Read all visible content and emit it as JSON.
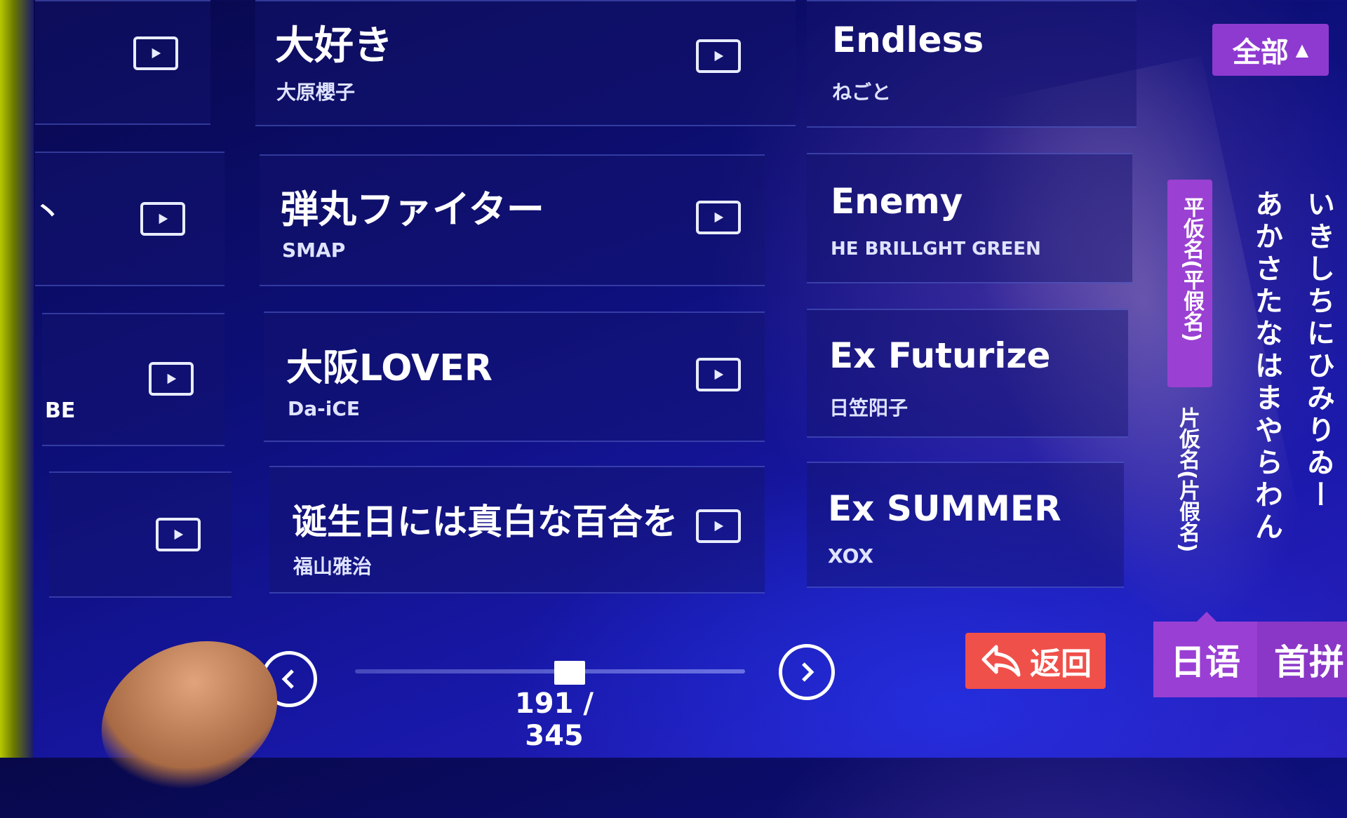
{
  "songs": {
    "left_column": [
      {
        "title": "大好き",
        "artist": "大原櫻子"
      },
      {
        "title": "弾丸ファイター",
        "artist": "SMAP"
      },
      {
        "title": "大阪LOVER",
        "artist": "Da-iCE"
      },
      {
        "title": "诞生日には真白な百合を",
        "artist": "福山雅治"
      }
    ],
    "right_column": [
      {
        "title": "Endless",
        "artist": "ねごと"
      },
      {
        "title": "Enemy",
        "artist": "HE BRILLGHT GREEN"
      },
      {
        "title": "Ex Futurize",
        "artist": "日笠阳子"
      },
      {
        "title": "Ex SUMMER",
        "artist": "XOX"
      }
    ],
    "cut_off_fragment": "BE",
    "cut_off_mark": "丶"
  },
  "filter": {
    "all_label": "全部",
    "all_indicator": "▲"
  },
  "index_sidebar": {
    "hiragana_tab": "平仮名(平假名)",
    "katakana_tab": "片仮名(片假名)",
    "kana_columns": [
      "あかさたなはまやらわん",
      "いきしちにひみりゐー"
    ]
  },
  "pagination": {
    "current": "191",
    "separator": "/",
    "total": "345",
    "progress_fraction": 0.55
  },
  "actions": {
    "back_label": "返回",
    "language_label": "日语",
    "first_letter_label": "首拼"
  },
  "colors": {
    "accent_purple": "#9a40d2",
    "back_red": "#f0504a"
  }
}
